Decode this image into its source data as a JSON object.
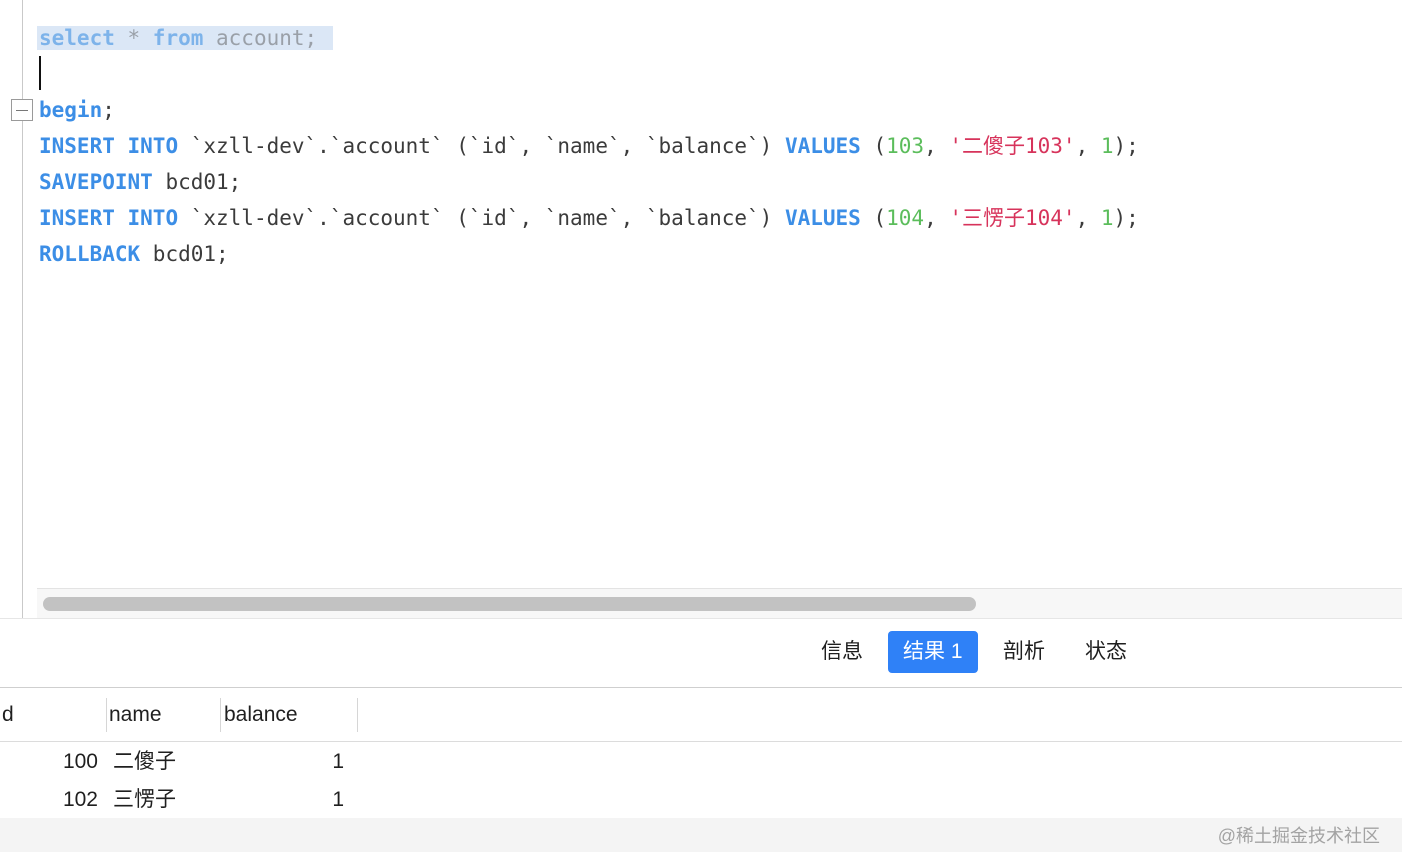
{
  "editor": {
    "lines": {
      "l1": {
        "kw1": "select",
        "op": " * ",
        "kw2": "from",
        "rest": " account;"
      },
      "l3": {
        "kw": "begin",
        "rest": ";"
      },
      "l4": {
        "kw1": "INSERT",
        "sp1": " ",
        "kw2": "INTO",
        "mid": " `xzll-dev`.`account` (`id`, `name`, `balance`) ",
        "kw3": "VALUES",
        "open": " (",
        "n1": "103",
        "c1": ", ",
        "s1": "'二傻子103'",
        "c2": ", ",
        "n2": "1",
        "close": ");"
      },
      "l5": {
        "kw": "SAVEPOINT",
        "rest": " bcd01;"
      },
      "l6": {
        "kw1": "INSERT",
        "sp1": " ",
        "kw2": "INTO",
        "mid": " `xzll-dev`.`account` (`id`, `name`, `balance`) ",
        "kw3": "VALUES",
        "open": " (",
        "n1": "104",
        "c1": ", ",
        "s1": "'三愣子104'",
        "c2": ", ",
        "n2": "1",
        "close": ");"
      },
      "l7": {
        "kw": "ROLLBACK",
        "rest": " bcd01;"
      }
    }
  },
  "tabs": {
    "info": "信息",
    "result": "结果 1",
    "profile": "剖析",
    "status": "状态"
  },
  "grid": {
    "columns": {
      "id": "d",
      "name": "name",
      "balance": "balance"
    },
    "rows": [
      {
        "id": "100",
        "name": "二傻子",
        "balance": "1"
      },
      {
        "id": "102",
        "name": "三愣子",
        "balance": "1"
      }
    ]
  },
  "watermark": "@稀土掘金技术社区",
  "colors": {
    "accent": "#2f81f7",
    "keyword": "#3c8ee6",
    "number": "#5bbd5b",
    "string": "#d7335b",
    "selection": "#dbe7f6"
  }
}
